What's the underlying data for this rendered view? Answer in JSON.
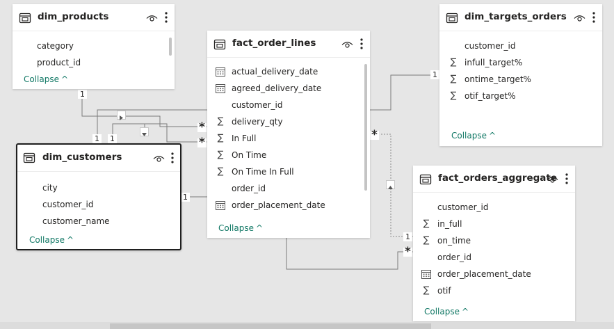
{
  "tables": {
    "dim_products": {
      "title": "dim_products",
      "fields": [
        {
          "name": "category",
          "icon": "none"
        },
        {
          "name": "product_id",
          "icon": "none"
        }
      ],
      "collapse": "Collapse"
    },
    "fact_order_lines": {
      "title": "fact_order_lines",
      "fields": [
        {
          "name": "actual_delivery_date",
          "icon": "calendar-icon"
        },
        {
          "name": "agreed_delivery_date",
          "icon": "calendar-icon"
        },
        {
          "name": "customer_id",
          "icon": "none"
        },
        {
          "name": "delivery_qty",
          "icon": "sigma-icon"
        },
        {
          "name": "In Full",
          "icon": "sigma-icon"
        },
        {
          "name": "On Time",
          "icon": "sigma-icon"
        },
        {
          "name": "On Time In Full",
          "icon": "sigma-icon"
        },
        {
          "name": "order_id",
          "icon": "none"
        },
        {
          "name": "order_placement_date",
          "icon": "calendar-icon"
        }
      ],
      "collapse": "Collapse"
    },
    "dim_targets_orders": {
      "title": "dim_targets_orders",
      "fields": [
        {
          "name": "customer_id",
          "icon": "none"
        },
        {
          "name": "infull_target%",
          "icon": "sigma-icon"
        },
        {
          "name": "ontime_target%",
          "icon": "sigma-icon"
        },
        {
          "name": "otif_target%",
          "icon": "sigma-icon"
        }
      ],
      "collapse": "Collapse"
    },
    "dim_customers": {
      "title": "dim_customers",
      "fields": [
        {
          "name": "city",
          "icon": "none"
        },
        {
          "name": "customer_id",
          "icon": "none"
        },
        {
          "name": "customer_name",
          "icon": "none"
        }
      ],
      "collapse": "Collapse"
    },
    "fact_orders_aggregate": {
      "title": "fact_orders_aggregate",
      "fields": [
        {
          "name": "customer_id",
          "icon": "none"
        },
        {
          "name": "in_full",
          "icon": "sigma-icon"
        },
        {
          "name": "on_time",
          "icon": "sigma-icon"
        },
        {
          "name": "order_id",
          "icon": "none"
        },
        {
          "name": "order_placement_date",
          "icon": "calendar-icon"
        },
        {
          "name": "otif",
          "icon": "sigma-icon"
        }
      ],
      "collapse": "Collapse"
    }
  },
  "relationships": {
    "one": "1",
    "many": "*"
  },
  "colors": {
    "canvas": "#e6e6e6",
    "link": "#6b6b6b",
    "collapse_link": "#117865",
    "selected_border": "#1f1f1f"
  }
}
